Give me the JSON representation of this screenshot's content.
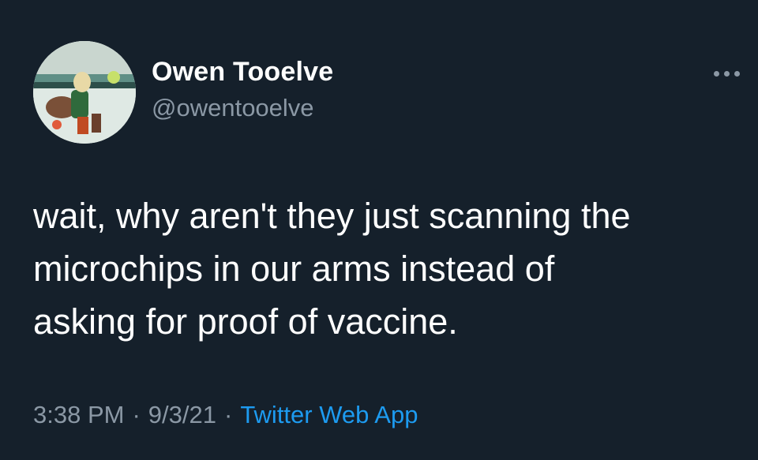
{
  "tweet": {
    "author": {
      "display_name": "Owen Tooelve",
      "handle": "@owentooelve",
      "avatar_icon": "profile-photo"
    },
    "more_icon": "more-horizontal-icon",
    "text_lines": [
      "wait, why aren't they just scanning the",
      "microchips in our arms instead of",
      "asking for proof of vaccine."
    ],
    "time": "3:38 PM",
    "separator": "·",
    "date": "9/3/21",
    "source": "Twitter Web App"
  },
  "colors": {
    "background": "#15202b",
    "primary_text": "#ffffff",
    "secondary_text": "#8b98a5",
    "link": "#1d9bf0"
  }
}
